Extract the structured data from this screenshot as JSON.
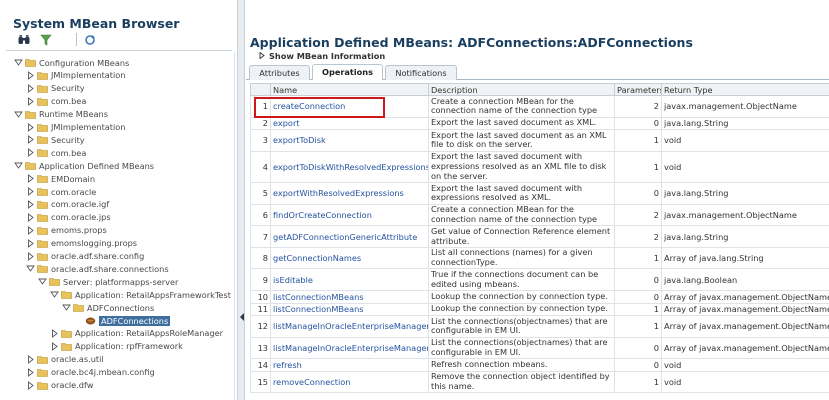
{
  "left_panel": {
    "title": "System MBean Browser",
    "toolbar": [
      "binoculars-icon",
      "filter-icon",
      "refresh-icon"
    ],
    "tree": [
      {
        "label": "Configuration MBeans",
        "level": 0,
        "expanded": true,
        "folder": true
      },
      {
        "label": "JMImplementation",
        "level": 1,
        "expanded": false,
        "folder": true
      },
      {
        "label": "Security",
        "level": 1,
        "expanded": false,
        "folder": true
      },
      {
        "label": "com.bea",
        "level": 1,
        "expanded": false,
        "folder": true
      },
      {
        "label": "Runtime MBeans",
        "level": 0,
        "expanded": true,
        "folder": true
      },
      {
        "label": "JMImplementation",
        "level": 1,
        "expanded": false,
        "folder": true
      },
      {
        "label": "Security",
        "level": 1,
        "expanded": false,
        "folder": true
      },
      {
        "label": "com.bea",
        "level": 1,
        "expanded": false,
        "folder": true
      },
      {
        "label": "Application Defined MBeans",
        "level": 0,
        "expanded": true,
        "folder": true
      },
      {
        "label": "EMDomain",
        "level": 1,
        "expanded": false,
        "folder": true
      },
      {
        "label": "com.oracle",
        "level": 1,
        "expanded": false,
        "folder": true
      },
      {
        "label": "com.oracle.igf",
        "level": 1,
        "expanded": false,
        "folder": true
      },
      {
        "label": "com.oracle.jps",
        "level": 1,
        "expanded": false,
        "folder": true
      },
      {
        "label": "emoms.props",
        "level": 1,
        "expanded": false,
        "folder": true
      },
      {
        "label": "emomslogging.props",
        "level": 1,
        "expanded": false,
        "folder": true
      },
      {
        "label": "oracle.adf.share.config",
        "level": 1,
        "expanded": false,
        "folder": true
      },
      {
        "label": "oracle.adf.share.connections",
        "level": 1,
        "expanded": true,
        "folder": true
      },
      {
        "label": "Server: platformapps-server",
        "level": 2,
        "expanded": true,
        "folder": true
      },
      {
        "label": "Application: RetailAppsFrameworkTest",
        "level": 3,
        "expanded": true,
        "folder": true
      },
      {
        "label": "ADFConnections",
        "level": 4,
        "expanded": true,
        "folder": true
      },
      {
        "label": "ADFConnections",
        "level": 5,
        "expanded": null,
        "folder": false,
        "selected": true
      },
      {
        "label": "Application: RetailAppsRoleManager",
        "level": 3,
        "expanded": false,
        "folder": true
      },
      {
        "label": "Application: rpfFramework",
        "level": 3,
        "expanded": false,
        "folder": true
      },
      {
        "label": "oracle.as.util",
        "level": 1,
        "expanded": false,
        "folder": true
      },
      {
        "label": "oracle.bc4j.mbean.config",
        "level": 1,
        "expanded": false,
        "folder": true
      },
      {
        "label": "oracle.dfw",
        "level": 1,
        "expanded": false,
        "folder": true
      }
    ]
  },
  "right_panel": {
    "title": "Application Defined MBeans: ADFConnections:ADFConnections",
    "info_toggle": "Show MBean Information",
    "tabs": [
      {
        "label": "Attributes",
        "active": false
      },
      {
        "label": "Operations",
        "active": true
      },
      {
        "label": "Notifications",
        "active": false
      }
    ],
    "columns": [
      "Name",
      "Description",
      "Parameters",
      "Return Type"
    ],
    "rows": [
      {
        "n": "1",
        "name": "createConnection",
        "desc": "Create a connection MBean for the connection name of the connection type",
        "params": "2",
        "ret": "javax.management.ObjectName",
        "lines": 2,
        "highlight": true
      },
      {
        "n": "2",
        "name": "export",
        "desc": "Export the last saved document as XML.",
        "params": "0",
        "ret": "java.lang.String",
        "lines": 1
      },
      {
        "n": "3",
        "name": "exportToDisk",
        "desc": "Export the last saved document as an XML file to disk on the server.",
        "params": "1",
        "ret": "void",
        "lines": 2
      },
      {
        "n": "4",
        "name": "exportToDiskWithResolvedExpressions",
        "desc": "Export the last saved document with expressions resolved as an XML file to disk on the server.",
        "params": "1",
        "ret": "void",
        "lines": 3
      },
      {
        "n": "5",
        "name": "exportWithResolvedExpressions",
        "desc": "Export the last saved document with expressions resolved as XML.",
        "params": "0",
        "ret": "java.lang.String",
        "lines": 2
      },
      {
        "n": "6",
        "name": "findOrCreateConnection",
        "desc": "Create a connection MBean for the connection name of the connection type",
        "params": "2",
        "ret": "javax.management.ObjectName",
        "lines": 2
      },
      {
        "n": "7",
        "name": "getADFConnectionGenericAttribute",
        "desc": "Get value of Connection Reference element attribute.",
        "params": "2",
        "ret": "java.lang.String",
        "lines": 2
      },
      {
        "n": "8",
        "name": "getConnectionNames",
        "desc": "List all connections (names) for a given connectionType.",
        "params": "1",
        "ret": "Array of java.lang.String",
        "lines": 2
      },
      {
        "n": "9",
        "name": "isEditable",
        "desc": "True if the connections document can be edited using mbeans.",
        "params": "0",
        "ret": "java.lang.Boolean",
        "lines": 2
      },
      {
        "n": "10",
        "name": "listConnectionMBeans",
        "desc": "Lookup the connection by connection type.",
        "params": "0",
        "ret": "Array of javax.management.ObjectName",
        "lines": 1
      },
      {
        "n": "11",
        "name": "listConnectionMBeans",
        "desc": "Lookup the connection by connection type.",
        "params": "1",
        "ret": "Array of javax.management.ObjectName",
        "lines": 1
      },
      {
        "n": "12",
        "name": "listManageInOracleEnterpriseManagerCor",
        "desc": "List the connections(objectnames) that are configurable in EM UI.",
        "params": "1",
        "ret": "Array of javax.management.ObjectName",
        "lines": 2
      },
      {
        "n": "13",
        "name": "listManageInOracleEnterpriseManagerCor",
        "desc": "List the connections(objectnames) that are configurable in EM UI.",
        "params": "0",
        "ret": "Array of javax.management.ObjectName",
        "lines": 2
      },
      {
        "n": "14",
        "name": "refresh",
        "desc": "Refresh connection mbeans.",
        "params": "0",
        "ret": "void",
        "lines": 1
      },
      {
        "n": "15",
        "name": "removeConnection",
        "desc": "Remove the connection object identified by this name.",
        "params": "1",
        "ret": "void",
        "lines": 2
      }
    ]
  },
  "colors": {
    "title": "#1a3e5f",
    "link": "#2553a0",
    "highlight_box": "#d0181b",
    "selected_node": "#3f6f9f",
    "folder": "#e8c25a"
  }
}
